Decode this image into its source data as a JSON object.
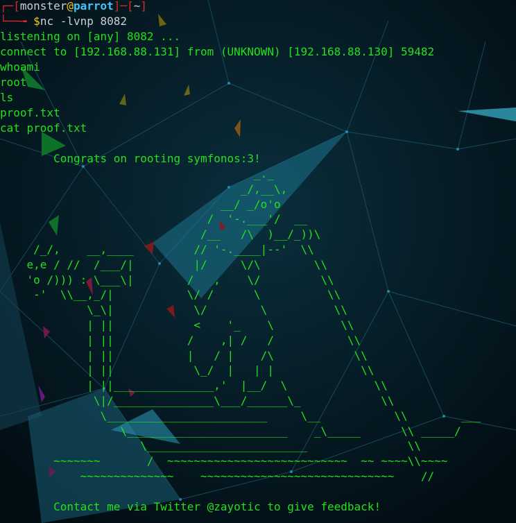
{
  "prompt": {
    "user": "monster",
    "at": "@",
    "host": "parrot",
    "dir": "~",
    "dollar": "$",
    "command": "nc -lvnp 8082"
  },
  "output": {
    "listen": "listening on [any] 8082 ...",
    "connect": "connect to [192.168.88.131] from (UNKNOWN) [192.168.88.130] 59482",
    "cmd1": "whoami",
    "out1": "root",
    "cmd2": "ls",
    "out2": "proof.txt",
    "cmd3": "cat proof.txt"
  },
  "proof": {
    "congrats": "        Congrats on rooting symfonos:3!",
    "ascii_art": "                                      _._\n                                    _/,__\\,\n                                 __/ _/o'o\n                               /  '-.___'/  __\n                              /__   /\\  )__/_))\\\n     /_/,    __,____         // '-.____|--'  \\\\\n    e,e / //  /___/|         |/     \\/\\        \\\\\n    'o /))) : \\___\\|        /   ,    \\/         \\\\\n     -'  \\\\__,_/|           \\/ /      \\          \\\\\n             \\_\\|            \\/        \\          \\\\\n             | ||            <    '_    \\          \\\\\n             | ||           /    ,| /   /           \\\\\n             | ||           |   / |    /\\            \\\\\n             | ||            \\_/  |   | |             \\\\\n             | ||_______________,'  |__/  \\             \\\\\n              \\|/_______________\\___/______\\_            \\\\\n               \\________________________     \\__           \\\\        ___\n                  \\________________________    _\\_____      \\\\ _____/\n                     \\________________________               \\\\\n        ~~~~~~~       /  ~~~~~~~~~~~~~~~~~~~~~~~~~~~  ~~ ~~~~\\\\~~~~\n            ~~~~~~~~~~~~~~    ~~~~~~~~~~~~~~~~~~~~~~~~~~~~~    //",
    "contact": "        Contact me via Twitter @zayotic to give feedback!"
  },
  "colors": {
    "background": "#02121a",
    "text_green": "#25e01c",
    "prompt_red": "#e0262a",
    "prompt_host_blue": "#3ec7ff",
    "prompt_yellow": "#f4c51d"
  },
  "icons": {
    "wallpaper": "polygon-network-wallpaper"
  }
}
